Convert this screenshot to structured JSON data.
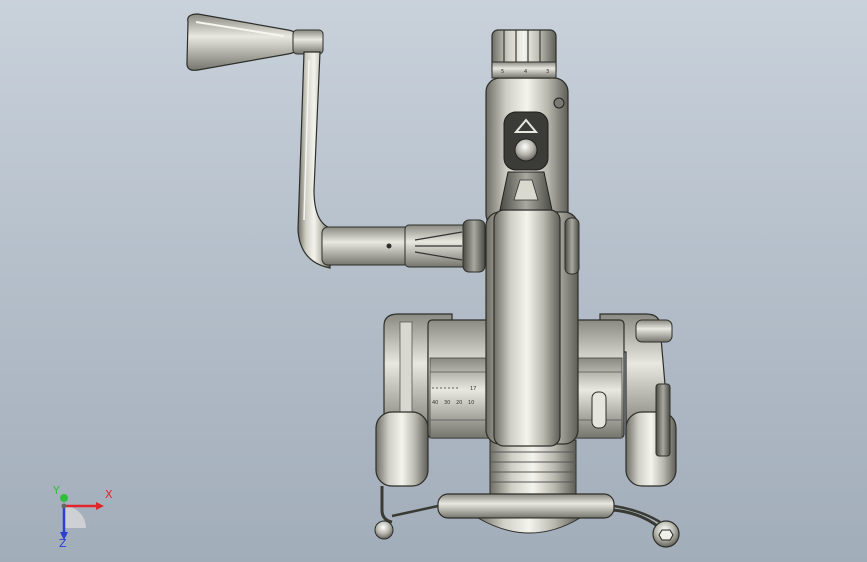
{
  "viewport": {
    "background_top": "#c9d2db",
    "background_bottom": "#a2adba"
  },
  "model": {
    "dial_numbers": [
      "5",
      "4",
      "3"
    ],
    "scale_row_1": [
      "17"
    ],
    "scale_row_2": [
      "40",
      "30",
      "20",
      "10"
    ],
    "arrow_marker": "up-triangle"
  },
  "triad": {
    "x_label": "X",
    "y_label": "Y",
    "z_label": "Z",
    "x_color": "#e0262b",
    "y_color": "#2fbf3a",
    "z_color": "#2a3fd1"
  }
}
